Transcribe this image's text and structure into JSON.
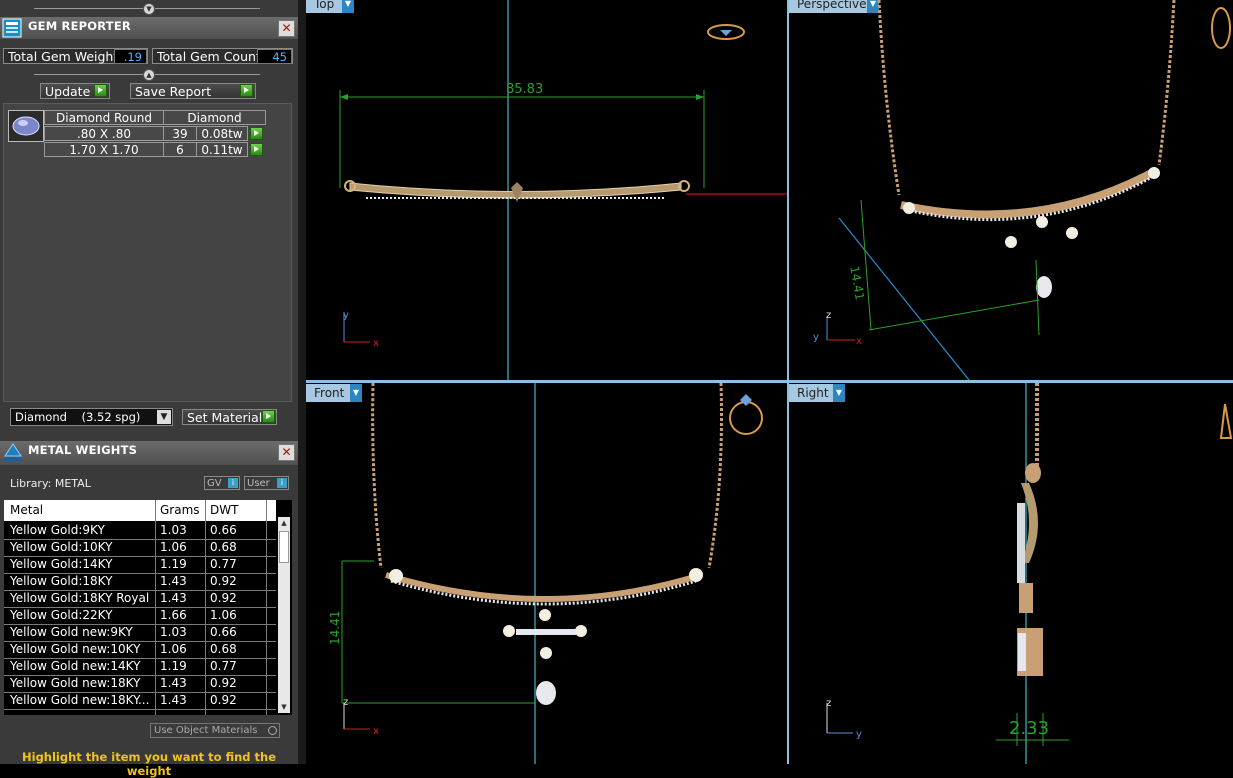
{
  "gem_reporter": {
    "title": "GEM REPORTER",
    "total_weight_label": "Total Gem Weight",
    "total_weight_value": ".19",
    "total_count_label": "Total Gem Count",
    "total_count_value": "45",
    "update_label": "Update",
    "save_report_label": "Save Report",
    "table": {
      "shape": "Diamond Round",
      "material": "Diamond",
      "rows": [
        {
          "size": ".80 X .80",
          "count": "39",
          "weight": "0.08tw"
        },
        {
          "size": "1.70 X 1.70",
          "count": "6",
          "weight": "0.11tw"
        }
      ]
    },
    "material_select": "Diamond    (3.52 spg)",
    "set_material_label": "Set Material"
  },
  "metal_weights": {
    "title": "METAL WEIGHTS",
    "library_label": "Library: METAL",
    "gv_label": "GV",
    "user_label": "User",
    "columns": [
      "Metal",
      "Grams",
      "DWT"
    ],
    "rows": [
      {
        "metal": "Yellow Gold:9KY",
        "grams": "1.03",
        "dwt": "0.66"
      },
      {
        "metal": "Yellow Gold:10KY",
        "grams": "1.06",
        "dwt": "0.68"
      },
      {
        "metal": "Yellow Gold:14KY",
        "grams": "1.19",
        "dwt": "0.77"
      },
      {
        "metal": "Yellow Gold:18KY",
        "grams": "1.43",
        "dwt": "0.92"
      },
      {
        "metal": "Yellow Gold:18KY Royal",
        "grams": "1.43",
        "dwt": "0.92"
      },
      {
        "metal": "Yellow Gold:22KY",
        "grams": "1.66",
        "dwt": "1.06"
      },
      {
        "metal": "Yellow Gold new:9KY",
        "grams": "1.03",
        "dwt": "0.66"
      },
      {
        "metal": "Yellow Gold new:10KY",
        "grams": "1.06",
        "dwt": "0.68"
      },
      {
        "metal": "Yellow Gold new:14KY",
        "grams": "1.19",
        "dwt": "0.77"
      },
      {
        "metal": "Yellow Gold new:18KY",
        "grams": "1.43",
        "dwt": "0.92"
      },
      {
        "metal": "Yellow Gold new:18KY...",
        "grams": "1.43",
        "dwt": "0.92"
      }
    ],
    "use_object_materials": "Use Object Materials",
    "hint": "Highlight the item you want to find the weight"
  },
  "viewports": {
    "top": {
      "label": "Top",
      "dimension": "85.83"
    },
    "perspective": {
      "label": "Perspective",
      "dimension": "14.41"
    },
    "front": {
      "label": "Front",
      "dimension": "14.41"
    },
    "right": {
      "label": "Right",
      "dimension": "2.33"
    }
  },
  "colors": {
    "accent": "#a7c8e0",
    "panel": "#3a3a3a",
    "gold": "#c8a87a",
    "dim_green": "#2aa12a"
  }
}
